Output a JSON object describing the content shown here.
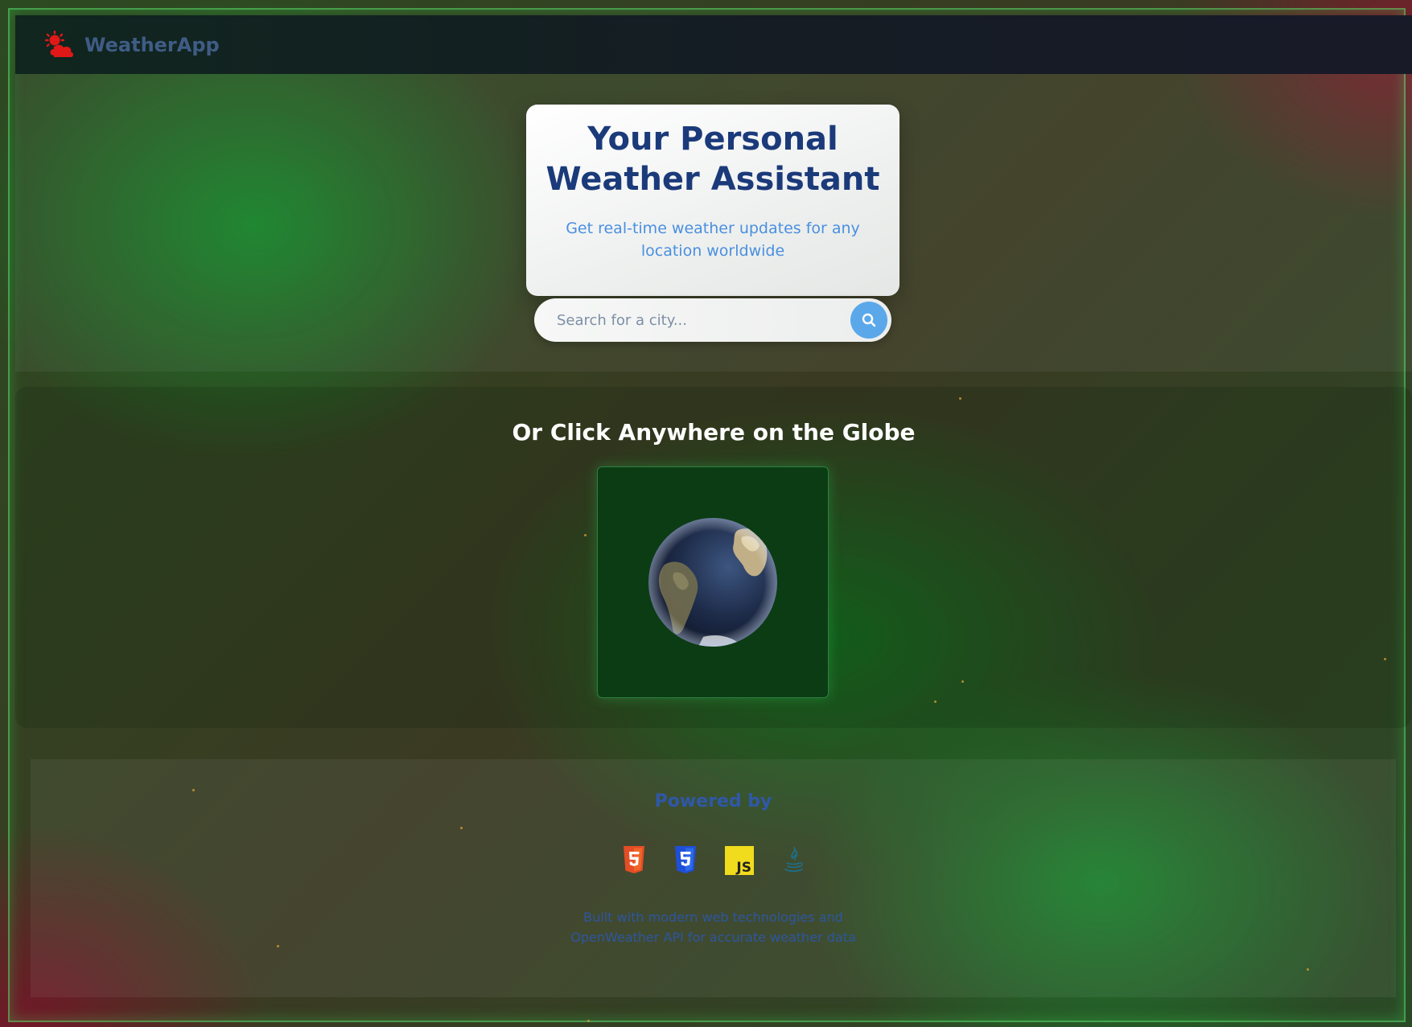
{
  "navbar": {
    "brand": "WeatherApp",
    "brand_icon": "sun-behind-cloud-icon",
    "brand_color": "#3f5c86",
    "icon_color": "#e01818"
  },
  "hero": {
    "title": "Your Personal Weather Assistant",
    "subtitle": "Get real-time weather updates for any location worldwide",
    "title_color": "#1b3a7a",
    "subtitle_color": "#4a8fe0"
  },
  "search": {
    "placeholder": "Search for a city...",
    "value": "",
    "button_icon": "search-icon",
    "button_color": "#5aa8ea"
  },
  "globe_section": {
    "heading": "Or Click Anywhere on the Globe",
    "globe_icon": "earth-globe"
  },
  "footer": {
    "powered_by": "Powered by",
    "technologies": [
      {
        "name": "HTML5",
        "icon": "html5-icon",
        "color": "#e44d26"
      },
      {
        "name": "CSS3",
        "icon": "css3-icon",
        "color": "#2d53e5"
      },
      {
        "name": "JavaScript",
        "icon": "javascript-icon",
        "color": "#f0db1c"
      },
      {
        "name": "Java",
        "icon": "java-icon",
        "color": "#1f6e88"
      }
    ],
    "description": "Built with modern web technologies and OpenWeather API for accurate weather data"
  }
}
